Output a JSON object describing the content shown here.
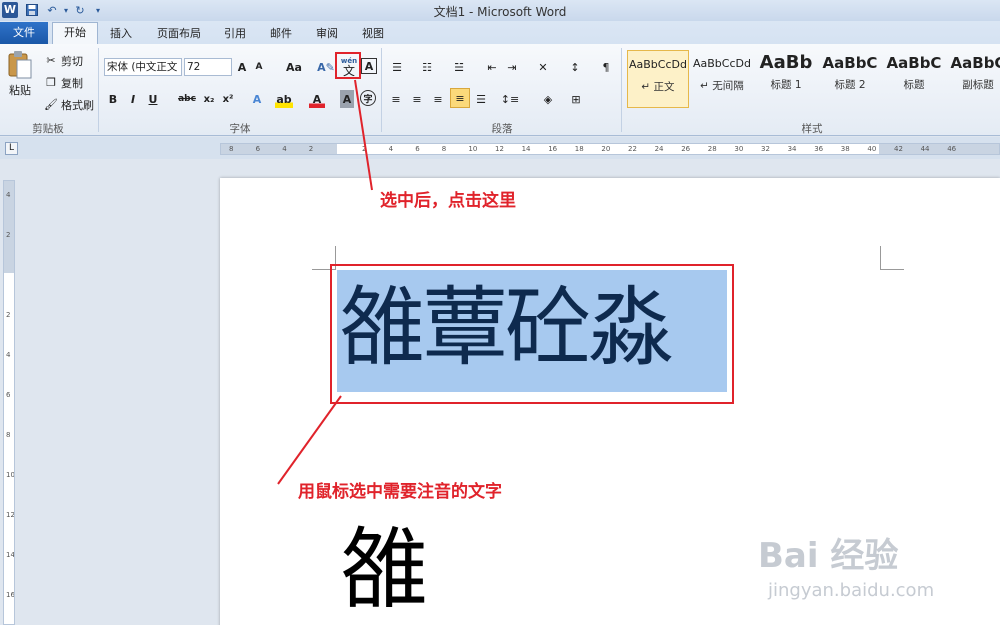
{
  "window": {
    "title": "文档1 - Microsoft Word"
  },
  "quick_access": {
    "logo": "W",
    "save_icon": "save-icon",
    "undo_icon": "undo-icon",
    "redo_icon": "redo-icon"
  },
  "tabs": [
    {
      "label": "文件"
    },
    {
      "label": "开始"
    },
    {
      "label": "插入"
    },
    {
      "label": "页面布局"
    },
    {
      "label": "引用"
    },
    {
      "label": "邮件"
    },
    {
      "label": "审阅"
    },
    {
      "label": "视图"
    }
  ],
  "clipboard": {
    "paste": "粘贴",
    "cut": "剪切",
    "copy": "复制",
    "format_painter": "格式刷",
    "label": "剪贴板"
  },
  "font": {
    "name": "宋体 (中文正文",
    "size": "72",
    "change_case": "Aa",
    "bold": "B",
    "italic": "I",
    "underline": "U",
    "strike": "abc",
    "subscript": "x₂",
    "superscript": "x²",
    "label": "字体",
    "phonetic_guide_glyph": "文",
    "phonetic_guide_ruby": "wén",
    "char_border": "A"
  },
  "paragraph": {
    "label": "段落"
  },
  "styles": {
    "label": "样式",
    "items": [
      {
        "preview": "AaBbCcDd",
        "name": "↵ 正文"
      },
      {
        "preview": "AaBbCcDd",
        "name": "↵ 无间隔"
      },
      {
        "preview": "AaBb",
        "name": "标题 1"
      },
      {
        "preview": "AaBbC",
        "name": "标题 2"
      },
      {
        "preview": "AaBbC",
        "name": "标题"
      },
      {
        "preview": "AaBbC",
        "name": "副标题"
      }
    ]
  },
  "ruler": {
    "ticks": [
      "8",
      "6",
      "4",
      "2",
      "",
      "2",
      "4",
      "6",
      "8",
      "10",
      "12",
      "14",
      "16",
      "18",
      "20",
      "22",
      "24",
      "26",
      "28",
      "30",
      "32",
      "34",
      "36",
      "38",
      "40",
      "42",
      "44",
      "46"
    ],
    "vticks": [
      "4",
      "2",
      "",
      "2",
      "4",
      "6",
      "8",
      "10",
      "12",
      "14",
      "16"
    ]
  },
  "document": {
    "selected_text": "雒蕈砼淼",
    "single_char": "雒"
  },
  "annotations": {
    "callout_top": "选中后，点击这里",
    "callout_bottom": "用鼠标选中需要注音的文字"
  },
  "watermark": {
    "brand": "Bai 经验",
    "url": "jingyan.baidu.com"
  },
  "colors": {
    "callout": "#e0232b",
    "selection": "#a7c9ef",
    "file_tab": "#1a57a8"
  }
}
